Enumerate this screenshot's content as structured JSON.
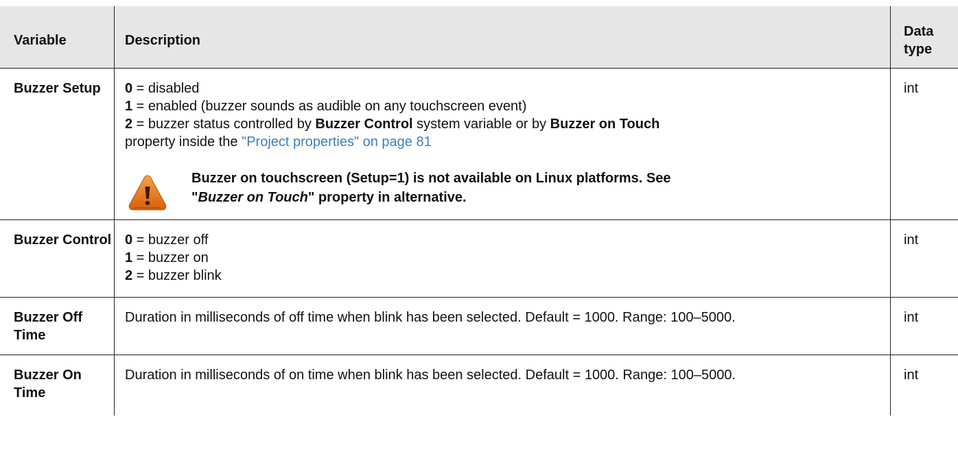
{
  "table": {
    "headers": {
      "variable": "Variable",
      "description": "Description",
      "data_type": "Data type"
    },
    "rows": [
      {
        "variable": "Buzzer Setup",
        "lines": [
          {
            "code": "0",
            "text": " = disabled"
          },
          {
            "code": "1",
            "text": " = enabled (buzzer sounds as audible on any touchscreen event)"
          }
        ],
        "line3": {
          "code": "2",
          "t1": " = buzzer status controlled by ",
          "b1": "Buzzer Control",
          "t2": " system variable or by ",
          "b2": "Buzzer on Touch",
          "t3": "property inside the ",
          "link": "\"Project properties\" on page 81"
        },
        "note": {
          "icon": "warning-icon",
          "line1": "Buzzer on touchscreen (Setup=1) is not available on Linux platforms. See",
          "q1": "\"",
          "italic": "Buzzer on Touch",
          "rest": "\" property in alternative."
        },
        "data_type": "int"
      },
      {
        "variable": "Buzzer Control",
        "lines": [
          {
            "code": "0",
            "text": " = buzzer off"
          },
          {
            "code": "1",
            "text": " = buzzer on"
          },
          {
            "code": "2",
            "text": " = buzzer blink"
          }
        ],
        "data_type": "int"
      },
      {
        "variable": "Buzzer Off Time",
        "description": "Duration in milliseconds of off time when blink has been selected. Default = 1000. Range: 100–5000.",
        "data_type": "int"
      },
      {
        "variable": "Buzzer On Time",
        "description": "Duration in milliseconds of on time when blink has been selected. Default = 1000. Range: 100–5000.",
        "data_type": "int"
      }
    ]
  },
  "colors": {
    "header_bg": "#e6e6e6",
    "link": "#3d7fb8",
    "warning": "#e8731a"
  }
}
